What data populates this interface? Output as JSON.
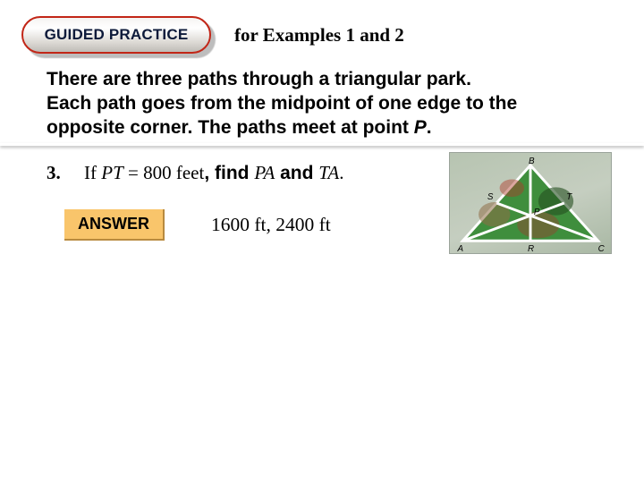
{
  "header": {
    "pill_label": "GUIDED PRACTICE",
    "for_examples": "for Examples 1 and 2"
  },
  "intro": {
    "line1": "There are three paths through a triangular park.",
    "line2": "Each path goes from the midpoint of one edge to the",
    "line3_a": "opposite corner. The paths meet at point ",
    "line3_p": "P",
    "line3_b": "."
  },
  "question": {
    "number": "3.",
    "lead": "If ",
    "var1": "PT",
    "eq": " = 800 feet",
    "comma": ", ",
    "find": "find ",
    "var2": "PA",
    "and": " and ",
    "var3": "TA",
    "dot": "."
  },
  "answer": {
    "label": "ANSWER",
    "text": "1600 ft, 2400 ft"
  },
  "diagram": {
    "vertices": {
      "A": "A",
      "B": "B",
      "C": "C"
    },
    "midpoints": {
      "R": "R",
      "S": "S",
      "T": "T"
    },
    "centroid": "P"
  }
}
